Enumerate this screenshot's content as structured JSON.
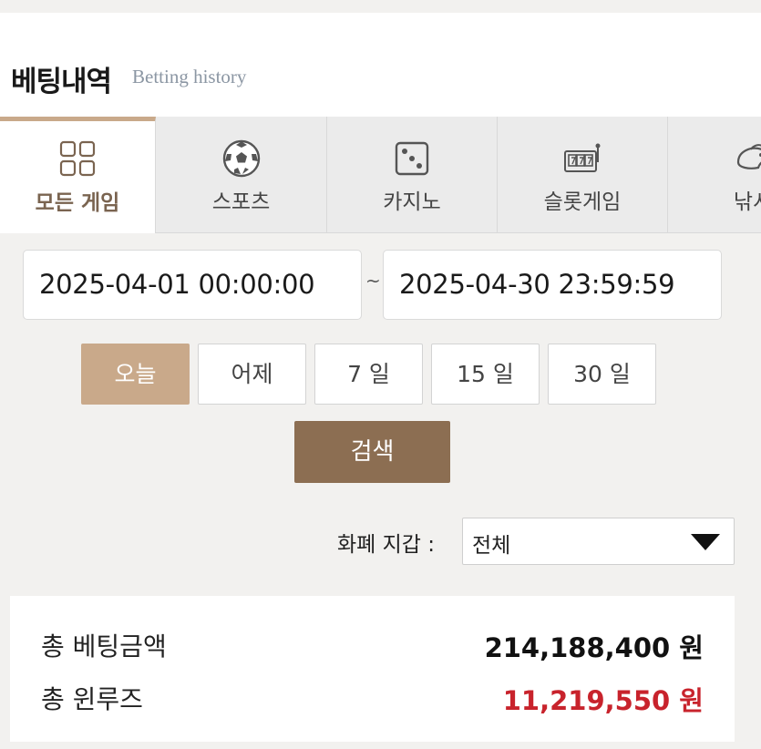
{
  "header": {
    "title": "베팅내역",
    "subtitle": "Betting history"
  },
  "tabs": [
    {
      "label": "모든 게임",
      "icon": "grid-icon",
      "active": true
    },
    {
      "label": "스포츠",
      "icon": "soccer-ball-icon",
      "active": false
    },
    {
      "label": "카지노",
      "icon": "dice-icon",
      "active": false
    },
    {
      "label": "슬롯게임",
      "icon": "slot-machine-icon",
      "active": false
    },
    {
      "label": "낚시",
      "icon": "fish-icon",
      "active": false
    }
  ],
  "date_range": {
    "start": "2025-04-01 00:00:00",
    "separator": "~",
    "end": "2025-04-30 23:59:59"
  },
  "quick_ranges": [
    "오늘",
    "어제",
    "7 일",
    "15 일",
    "30 일"
  ],
  "quick_active_index": 0,
  "search_label": "검색",
  "wallet": {
    "label": "화폐 지갑 :",
    "selected": "전체"
  },
  "summary": {
    "total_bet_label": "총 베팅금액",
    "total_bet_value": "214,188,400 원",
    "total_winloss_label": "총 윈루즈",
    "total_winloss_value": "11,219,550 원"
  },
  "colors": {
    "accent": "#c9a98a",
    "button": "#8c6e52",
    "negative": "#c8232c"
  }
}
